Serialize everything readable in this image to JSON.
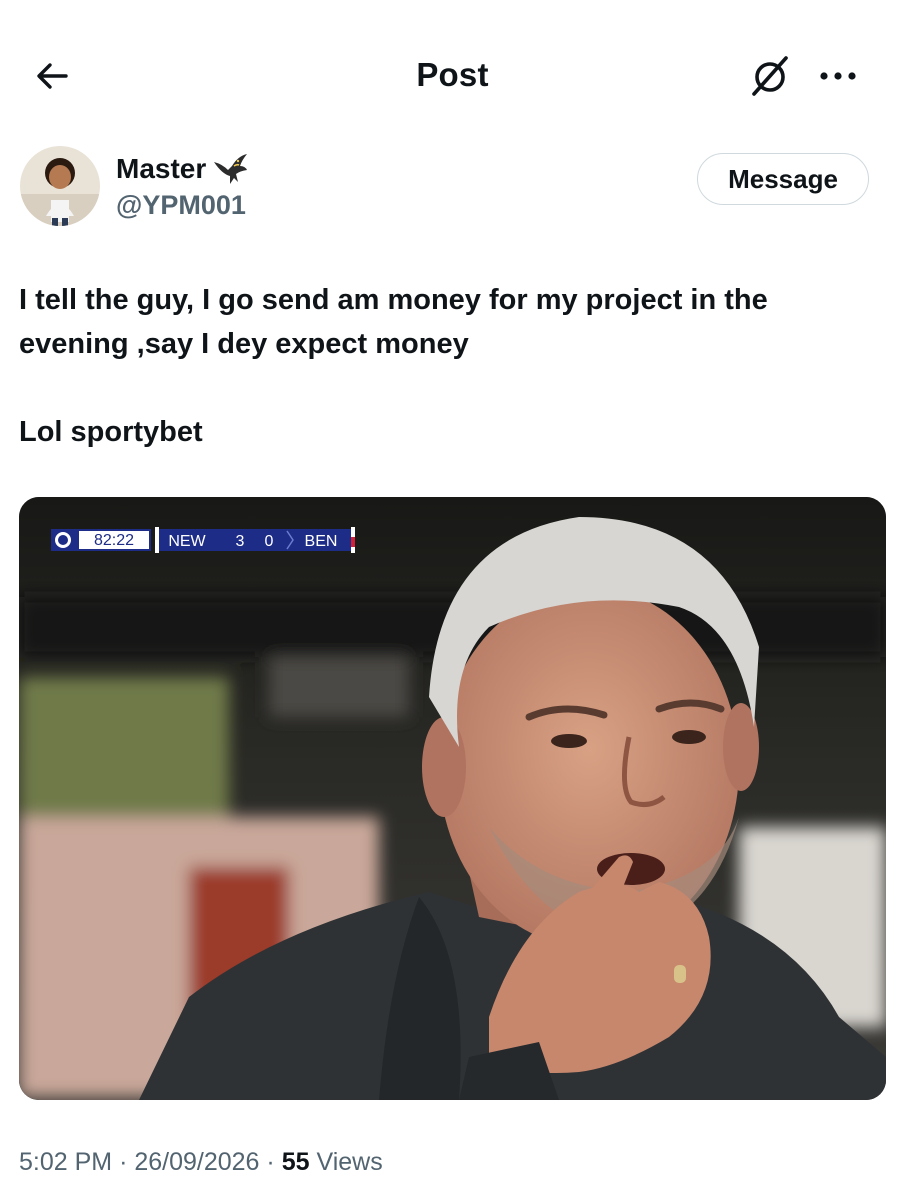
{
  "header": {
    "title": "Post",
    "back_icon": "arrow-left-icon",
    "grok_icon": "grok-icon",
    "more_icon": "more-dots-icon"
  },
  "author": {
    "display_name": "Master",
    "handle": "@YPM001",
    "name_emoji": "eagle-icon"
  },
  "actions": {
    "message_label": "Message"
  },
  "post": {
    "line1": "I tell the guy, I go send am  money for my project in the evening ,say I dey expect money",
    "line2": "Lol sportybet"
  },
  "media": {
    "scoreboard": {
      "clock": "82:22",
      "home": "NEW",
      "home_score": "3",
      "away_score": "0",
      "away": "BEN"
    }
  },
  "meta": {
    "time": "5:02 PM",
    "date": "26/09/2026",
    "views_count": "55",
    "views_label": "Views",
    "separator": "·"
  },
  "colors": {
    "text": "#0f1419",
    "secondary": "#536471",
    "border": "#cfd9de",
    "scoreboard_blue": "#1d2c86"
  }
}
